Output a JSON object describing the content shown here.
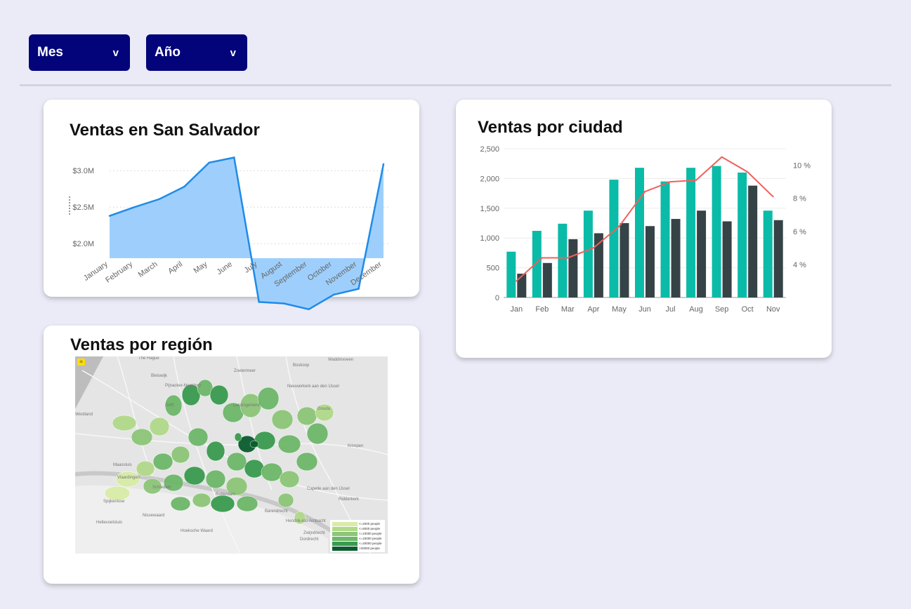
{
  "filters": [
    {
      "label": "Mes",
      "caret": "v"
    },
    {
      "label": "Año",
      "caret": "v"
    }
  ],
  "cards": {
    "san_salvador": {
      "title": "Ventas en San Salvador"
    },
    "ciudad": {
      "title": "Ventas por ciudad"
    },
    "region": {
      "title": "Ventas por región"
    }
  },
  "chart_data": [
    {
      "type": "area",
      "title": "Ventas en San Salvador",
      "categories": [
        "January",
        "February",
        "March",
        "April",
        "May",
        "June",
        "July",
        "August",
        "September",
        "October",
        "November",
        "December"
      ],
      "values": [
        2.38,
        2.5,
        2.61,
        2.78,
        3.11,
        3.18,
        1.2,
        1.18,
        1.1,
        1.3,
        1.38,
        3.09
      ],
      "y_ticks": [
        {
          "value": 2.0,
          "label": "$2.0M"
        },
        {
          "value": 2.5,
          "label": "$2.5M"
        },
        {
          "value": 3.0,
          "label": "$3.0M"
        }
      ],
      "ylim": [
        1.8,
        3.3
      ],
      "grid": true,
      "fill_color": "#9ecffc",
      "line_color": "#1f8be8"
    },
    {
      "type": "bar",
      "title": "Ventas por ciudad",
      "categories": [
        "Jan",
        "Feb",
        "Mar",
        "Apr",
        "May",
        "Jun",
        "Jul",
        "Aug",
        "Sep",
        "Oct",
        "Nov"
      ],
      "series": [
        {
          "values": [
            770,
            1120,
            1240,
            1460,
            1980,
            2180,
            1950,
            2180,
            2210,
            2100,
            1460
          ],
          "color": "#0abba8"
        },
        {
          "values": [
            400,
            580,
            980,
            1080,
            1250,
            1200,
            1320,
            1460,
            1280,
            1880,
            1300
          ],
          "color": "#364346"
        },
        {
          "type": "line",
          "axis": "right",
          "values": [
            3.0,
            4.4,
            4.4,
            5.0,
            6.3,
            8.4,
            9.0,
            9.1,
            10.5,
            9.6,
            8.1
          ],
          "color": "#f0605d"
        }
      ],
      "y_ticks": [
        "0",
        "500",
        "1,000",
        "1,500",
        "2,000",
        "2,500"
      ],
      "ylim": [
        0,
        2500
      ],
      "y2_ticks": [
        "4 %",
        "6 %",
        "8 %",
        "10 %"
      ],
      "y2lim": [
        2.0,
        11.0
      ],
      "grid": true
    }
  ],
  "map": {
    "menu_icon": "hamburger-menu-icon",
    "places": [
      "The Hague",
      "Zoetermeer",
      "Bleiswijk",
      "Pijnacker-Nootdorp",
      "Delft",
      "Lansingerland",
      "Nieuwerkerk aan den IJssel",
      "Gouda",
      "Boskoop",
      "Waddinxveen",
      "Westland",
      "Maassluis",
      "Vlaardingen",
      "Schiedam",
      "Rotterdam",
      "Capelle aan den IJssel",
      "Krimpen",
      "Ridderkerk",
      "Nissewaard",
      "Barendrecht",
      "Zwijndrecht",
      "Hoeksche Waard",
      "Dordrecht",
      "Hendrik-Ido-Ambacht",
      "Hellevoetsluis",
      "Spijkenisse"
    ],
    "legend": [
      "<=2000 people",
      "<=5000 people",
      "<=10000 people",
      "<=15000 people",
      "<=20000 people",
      ">20000 people"
    ],
    "legend_colors": [
      "#d8eca6",
      "#b1d98a",
      "#8cc678",
      "#6db76a",
      "#3a9b4f",
      "#0b5c2e"
    ]
  }
}
